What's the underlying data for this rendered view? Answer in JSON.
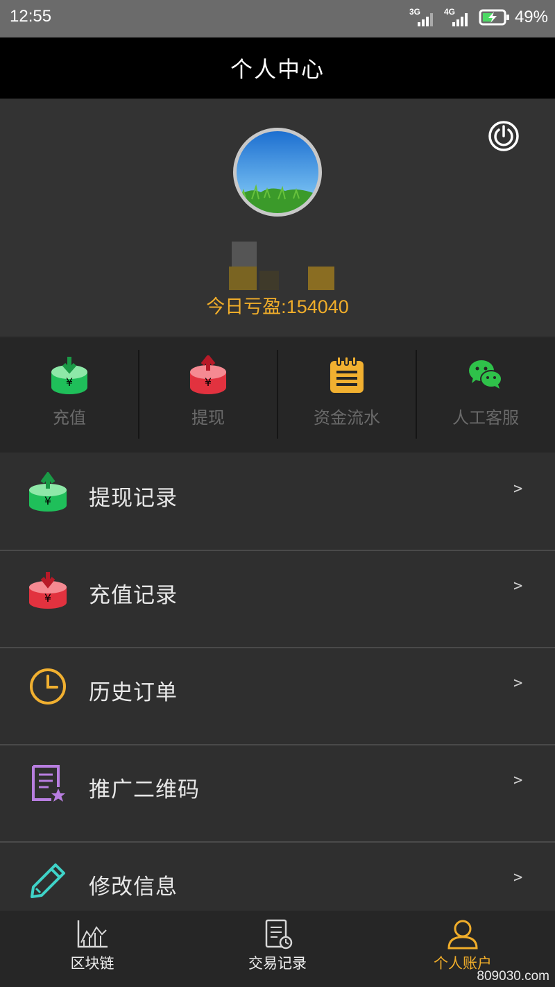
{
  "status_bar": {
    "time": "12:55",
    "net1": "3G",
    "net2": "4G",
    "battery": "49%"
  },
  "header": {
    "title": "个人中心"
  },
  "profile": {
    "pnl_label": "今日亏盈:154040"
  },
  "quick_actions": [
    {
      "label": "充值",
      "icon": "deposit-icon",
      "color": "#1fbf5a"
    },
    {
      "label": "提现",
      "icon": "withdraw-icon",
      "color": "#e2323f"
    },
    {
      "label": "资金流水",
      "icon": "notepad-icon",
      "color": "#f1b030"
    },
    {
      "label": "人工客服",
      "icon": "wechat-icon",
      "color": "#2fc24a"
    }
  ],
  "menu": [
    {
      "label": "提现记录",
      "icon": "withdraw-record-icon",
      "arrow": ">"
    },
    {
      "label": "充值记录",
      "icon": "deposit-record-icon",
      "arrow": ">"
    },
    {
      "label": "历史订单",
      "icon": "clock-icon",
      "arrow": ">"
    },
    {
      "label": "推广二维码",
      "icon": "document-star-icon",
      "arrow": ">"
    },
    {
      "label": "修改信息",
      "icon": "pencil-icon",
      "arrow": ">"
    }
  ],
  "tabs": [
    {
      "label": "区块链",
      "icon": "chart-icon",
      "active": false
    },
    {
      "label": "交易记录",
      "icon": "record-clock-icon",
      "active": false
    },
    {
      "label": "个人账户",
      "icon": "user-icon",
      "active": true
    }
  ],
  "watermark": "809030.com",
  "colors": {
    "accent": "#f0ad2a",
    "green": "#1fbf5a",
    "red": "#e2323f"
  }
}
